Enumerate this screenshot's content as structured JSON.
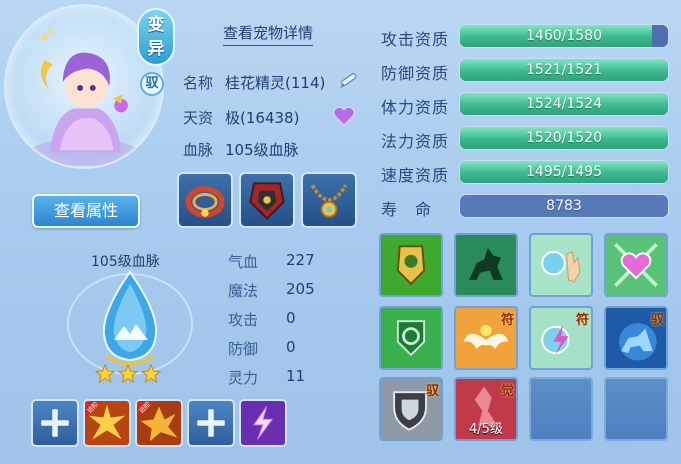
{
  "pet": {
    "badge_variant": "变异",
    "badge_tamed": "驭",
    "detail_link": "查看宠物详情",
    "view_attr_button": "查看属性",
    "name_label": "名称",
    "name_value": "桂花精灵(114)",
    "talent_label": "天资",
    "talent_value": "极(16438)",
    "bloodline_label": "血脉",
    "bloodline_value": "105级血脉"
  },
  "bloodline_panel": {
    "caption": "105级血脉",
    "stars": 3
  },
  "stats": [
    {
      "label": "气血",
      "value": "227"
    },
    {
      "label": "魔法",
      "value": "205"
    },
    {
      "label": "攻击",
      "value": "0"
    },
    {
      "label": "防御",
      "value": "0"
    },
    {
      "label": "灵力",
      "value": "11"
    }
  ],
  "aptitudes": [
    {
      "label": "攻击资质",
      "text": "1460/1580",
      "fill": 0.924
    },
    {
      "label": "防御资质",
      "text": "1521/1521",
      "fill": 1.0
    },
    {
      "label": "体力资质",
      "text": "1524/1524",
      "fill": 1.0
    },
    {
      "label": "法力资质",
      "text": "1520/1520",
      "fill": 1.0
    },
    {
      "label": "速度资质",
      "text": "1495/1495",
      "fill": 1.0
    }
  ],
  "lifespan": {
    "label": "寿　命",
    "value": "8783"
  },
  "bottom_slot_tags": [
    "进阶",
    "进阶"
  ],
  "skill_tags": {
    "fu": "符",
    "yu": "驭",
    "jue": "觉",
    "awaken_level": "4/5级"
  },
  "colors": {
    "bar_fill": "#3cb98f",
    "bar_track": "#4d6fb0",
    "button_blue": "#2d86cf"
  }
}
